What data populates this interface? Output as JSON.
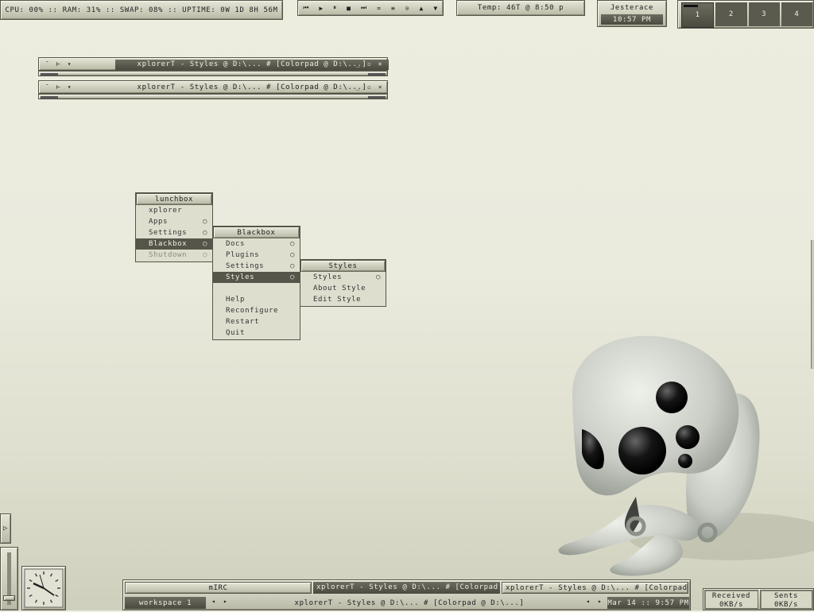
{
  "top": {
    "sysmon": "CPU: 00% :: RAM: 31% :: SWAP: 08% :: UPTIME: 0W 1D 8H 56M",
    "media_buttons": [
      "⏮",
      "▶",
      "⏸",
      "■",
      "⏭",
      "≖",
      "≡",
      "⊙",
      "▲",
      "▼"
    ],
    "temp": "Temp: 46T @ 8:50 p",
    "user": "Jesterace",
    "clock": "10:57 PM",
    "workspaces": [
      "1",
      "2",
      "3",
      "4"
    ]
  },
  "windows": [
    {
      "title": "xplorerT - Styles @ D:\\... # [Colorpad @ D:\\...]"
    },
    {
      "title": "xplorerT - Styles @ D:\\... # [Colorpad @ D:\\...]"
    }
  ],
  "menus": {
    "main": {
      "title": "lunchbox",
      "items": [
        "xplorer",
        "Apps",
        "Settings",
        "Blackbox",
        "Shutdown"
      ]
    },
    "blackbox": {
      "title": "Blackbox",
      "items": [
        "Docs",
        "Plugins",
        "Settings",
        "Styles",
        "Help",
        "Reconfigure",
        "Restart",
        "Quit"
      ]
    },
    "styles": {
      "title": "Styles",
      "items": [
        "Styles",
        "About Style",
        "Edit Style"
      ]
    }
  },
  "taskbar": {
    "tasks": [
      "mIRC",
      "xplorerT - Styles @ D:\\... # [Colorpad ...",
      "xplorerT - Styles @ D:\\... # [Colorpad ..."
    ],
    "workspace": "workspace 1",
    "active_title": "xplorerT - Styles @ D:\\... # [Colorpad @ D:\\...]",
    "datetime": "Mar 14 :: 9:57 PM",
    "received_label": "Received",
    "received_value": "0KB/s",
    "sent_label": "Sents",
    "sent_value": "0KB/s"
  },
  "colors": {
    "background": "#eaeadd",
    "accent": "#55554a",
    "panel": "#c9c9b7"
  }
}
